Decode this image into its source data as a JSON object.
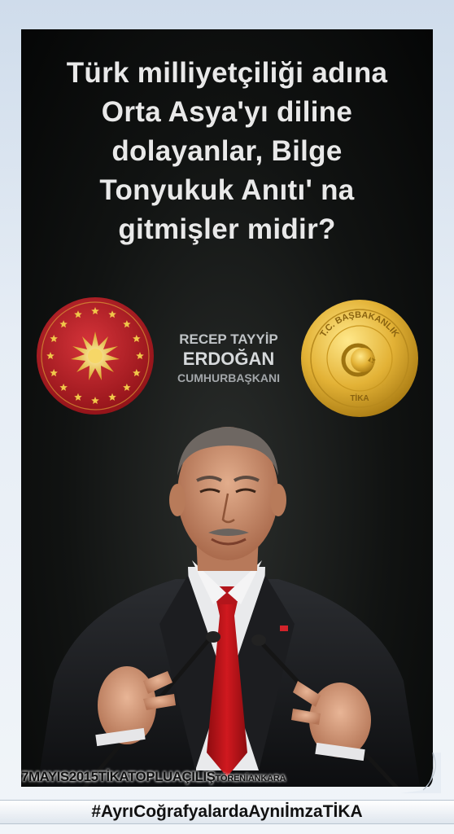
{
  "headline": {
    "lines": [
      "Türk milliyetçiliği adına",
      "Orta Asya'yı diline",
      "dolayanlar, Bilge",
      "Tonyukuk Anıtı' na",
      "gitmişler midir?"
    ]
  },
  "name_block": {
    "first_line": "RECEP TAYYİP",
    "second_line": "ERDOĞAN",
    "title": "CUMHURBAŞKANI"
  },
  "right_seal": {
    "ring_text": "T.C. BAŞBAKANLIK",
    "bottom_text": "TİKA"
  },
  "event_caption": {
    "date_prefix": "7MAYIS2015TİKATOPLUAÇILIŞ",
    "suffix": "TÖRENİANKARA"
  },
  "hashtag": "#AyrıCoğrafyalardaAynıİmzaTİKA",
  "colors": {
    "headline_text": "#e9e9e9",
    "seal_red": "#b81e24",
    "seal_gold": "#e6b534",
    "tie_red": "#c1141a",
    "background": "#0c0e0d"
  },
  "icons": {
    "left_seal": "presidential-seal-icon",
    "right_seal": "tika-gold-seal-icon"
  }
}
